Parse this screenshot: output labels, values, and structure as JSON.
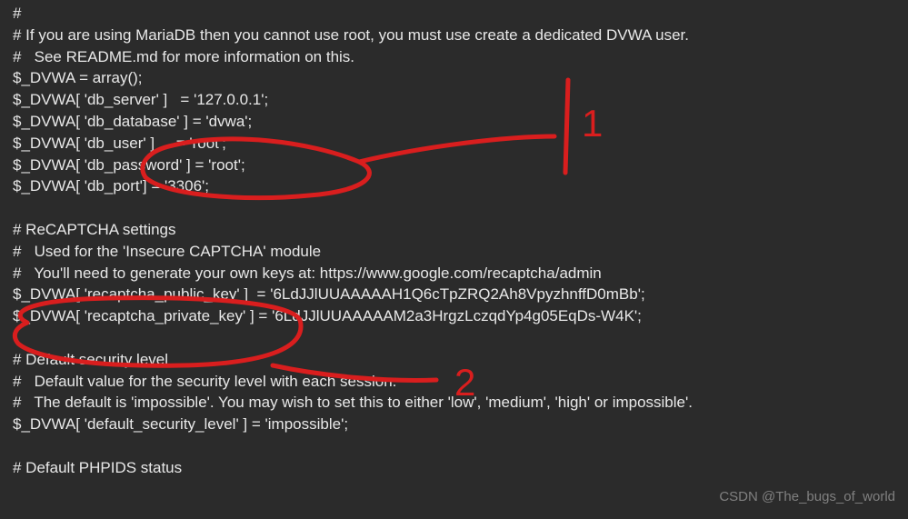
{
  "code": {
    "lines": [
      "#",
      "# If you are using MariaDB then you cannot use root, you must use create a dedicated DVWA user.",
      "#   See README.md for more information on this.",
      "$_DVWA = array();",
      "$_DVWA[ 'db_server' ]   = '127.0.0.1';",
      "$_DVWA[ 'db_database' ] = 'dvwa';",
      "$_DVWA[ 'db_user' ]     = 'root';",
      "$_DVWA[ 'db_password' ] = 'root';",
      "$_DVWA[ 'db_port'] = '3306';",
      "",
      "# ReCAPTCHA settings",
      "#   Used for the 'Insecure CAPTCHA' module",
      "#   You'll need to generate your own keys at: https://www.google.com/recaptcha/admin",
      "$_DVWA[ 'recaptcha_public_key' ]  = '6LdJJlUUAAAAAH1Q6cTpZRQ2Ah8VpyzhnffD0mBb';",
      "$_DVWA[ 'recaptcha_private_key' ] = '6LdJJlUUAAAAAM2a3HrgzLczqdYp4g05EqDs-W4K';",
      "",
      "# Default security level",
      "#   Default value for the security level with each session.",
      "#   The default is 'impossible'. You may wish to set this to either 'low', 'medium', 'high' or impossible'.",
      "$_DVWA[ 'default_security_level' ] = 'impossible';",
      "",
      "# Default PHPIDS status"
    ]
  },
  "annotations": {
    "label1": "1",
    "label2": "2"
  },
  "watermark": "CSDN @The_bugs_of_world"
}
